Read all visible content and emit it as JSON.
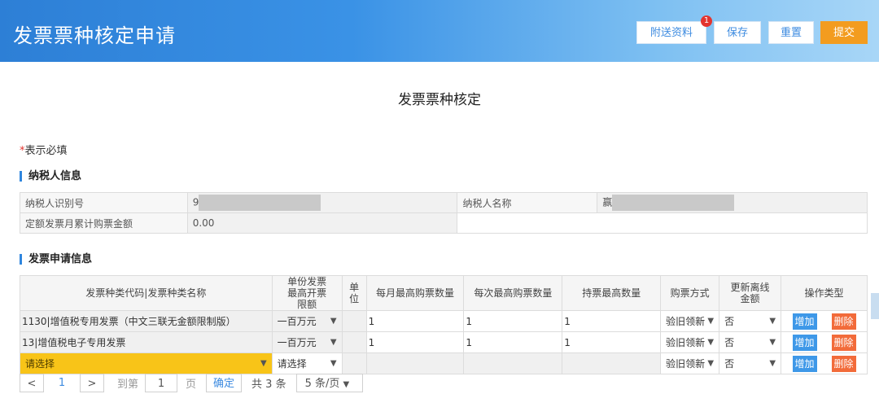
{
  "header": {
    "title": "发票票种核定申请",
    "buttons": {
      "attach": "附送资料",
      "save": "保存",
      "reset": "重置",
      "submit": "提交"
    },
    "attach_badge": "1"
  },
  "page_title": "发票票种核定",
  "required_note": {
    "star": "*",
    "text": "表示必填"
  },
  "taxpayer_section": {
    "title": "纳税人信息",
    "id_label": "纳税人识别号",
    "id_value_visible": "9",
    "name_label": "纳税人名称",
    "name_value_visible": "赢",
    "monthly_label": "定额发票月累计购票金额",
    "monthly_value": "0.00"
  },
  "apply_section": {
    "title": "发票申请信息",
    "headers": [
      "发票种类代码|发票种类名称",
      "单份发票最高开票限额",
      "单位",
      "每月最高购票数量",
      "每次最高购票数量",
      "持票最高数量",
      "购票方式",
      "更新离线金额",
      "操作类型"
    ],
    "rows": [
      {
        "type": "1130|增值税专用发票（中文三联无金额限制版）",
        "limit": "一百万元",
        "unit": "",
        "monthly": "1",
        "each": "1",
        "hold": "1",
        "method": "验旧领新",
        "offline": "否",
        "add": "增加",
        "del": "删除"
      },
      {
        "type": "13|增值税电子专用发票",
        "limit": "一百万元",
        "unit": "",
        "monthly": "1",
        "each": "1",
        "hold": "1",
        "method": "验旧领新",
        "offline": "否",
        "add": "增加",
        "del": "删除"
      },
      {
        "type": "请选择",
        "limit": "请选择",
        "unit": "",
        "monthly": "",
        "each": "",
        "hold": "",
        "method": "验旧领新",
        "offline": "否",
        "add": "增加",
        "del": "删除"
      }
    ]
  },
  "pagination": {
    "prev": "<",
    "page": "1",
    "next": ">",
    "goto_label": "到第",
    "goto_value": "1",
    "page_unit": "页",
    "confirm": "确定",
    "total": "共 3 条",
    "page_size": "5 条/页"
  },
  "colors": {
    "header_blue": "#2d7fd6",
    "submit_orange": "#f39c1f",
    "add_blue": "#3e98e8",
    "del_orange": "#f26b3a",
    "select_yellow": "#f8c418"
  },
  "icons": [
    "chevron-down-icon",
    "chevron-left-icon",
    "chevron-right-icon"
  ]
}
